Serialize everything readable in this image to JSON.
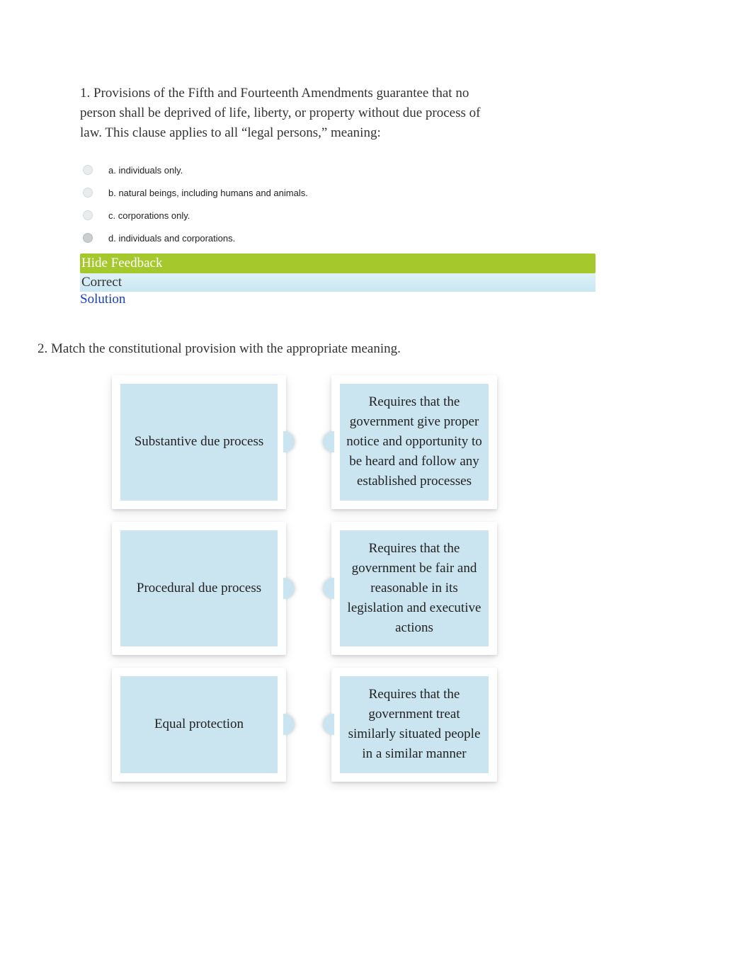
{
  "question1": {
    "prompt": "1. Provisions of the Fifth and Fourteenth Amendments guarantee that no person shall be deprived of life, liberty, or property without due process of law. This clause applies to all “legal persons,” meaning:",
    "options": {
      "a": "a. individuals only.",
      "b": "b. natural beings, including humans and animals.",
      "c": "c. corporations only.",
      "d": "d. individuals and corporations."
    },
    "feedback_toggle_label": "Hide Feedback",
    "feedback_status": "Correct",
    "solution_label": "Solution"
  },
  "question2": {
    "prompt": "2. Match the constitutional provision with the appropriate meaning.",
    "left": {
      "a": "Substantive due process",
      "b": "Procedural due process",
      "c": "Equal protection"
    },
    "right": {
      "a": "Requires that the government give proper notice and opportunity to be heard and follow any established processes",
      "b": "Requires that the government be fair and reasonable in its legislation and executive actions",
      "c": "Requires that the government treat similarly situated people in a similar manner"
    }
  }
}
